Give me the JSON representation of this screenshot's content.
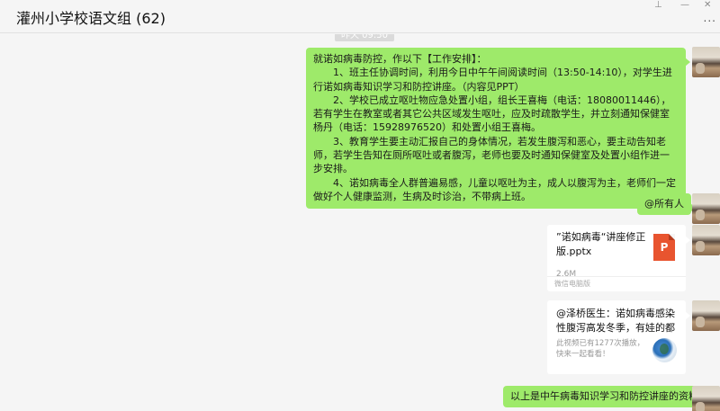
{
  "window": {
    "title": "灌州小学校语文组 (62)",
    "pin_icon": "pin-icon",
    "minimize_icon": "minimize-icon",
    "close_icon": "close-icon",
    "more_label": "..."
  },
  "chat": {
    "timestamp": "昨天 09:50",
    "messages": [
      {
        "type": "text",
        "paragraphs": [
          "就诺如病毒防控，作以下【工作安排】：",
          "　　1、班主任协调时间，利用今日中午午间阅读时间（13:50-14:10），对学生进行诺如病毒知识学习和防控讲座。（内容见PPT）",
          "　　2、学校已成立呕吐物应急处置小组，组长王喜梅（电话：18080011446），若有学生在教室或者其它公共区域发生呕吐，应及时疏散学生，并立刻通知保健室杨丹（电话：15928976520）和处置小组王喜梅。",
          "　　3、教育学生要主动汇报自己的身体情况，若发生腹泻和恶心，要主动告知老师，若学生告知在厕所呕吐或者腹泻，老师也要及时通知保健室及处置小组作进一步安排。",
          "　　4、诺如病毒全人群普遍易感，儿童以呕吐为主，成人以腹泻为主，老师们一定做好个人健康监测，生病及时诊治，不带病上班。"
        ]
      },
      {
        "type": "text",
        "text": "@所有人"
      },
      {
        "type": "file",
        "name": "”诺如病毒“讲座修正版.pptx",
        "size": "2.6M",
        "source": "微信电脑版",
        "icon_letter": "P",
        "icon": "ppt-file-icon"
      },
      {
        "type": "link",
        "title": "@泽桥医生：诺如病毒感染性腹泻高发冬季，有娃的都要小心…",
        "desc": "此视频已有1277次播放，快来一起看看！",
        "thumb": "video-thumbnail"
      },
      {
        "type": "text",
        "text": "以上是中午病毒知识学习和防控讲座的资料"
      }
    ]
  },
  "colors": {
    "own_bubble": "#9eea6a",
    "card_bg": "#ffffff",
    "chat_bg": "#f5f5f5",
    "ppt_icon": "#e8542f"
  }
}
